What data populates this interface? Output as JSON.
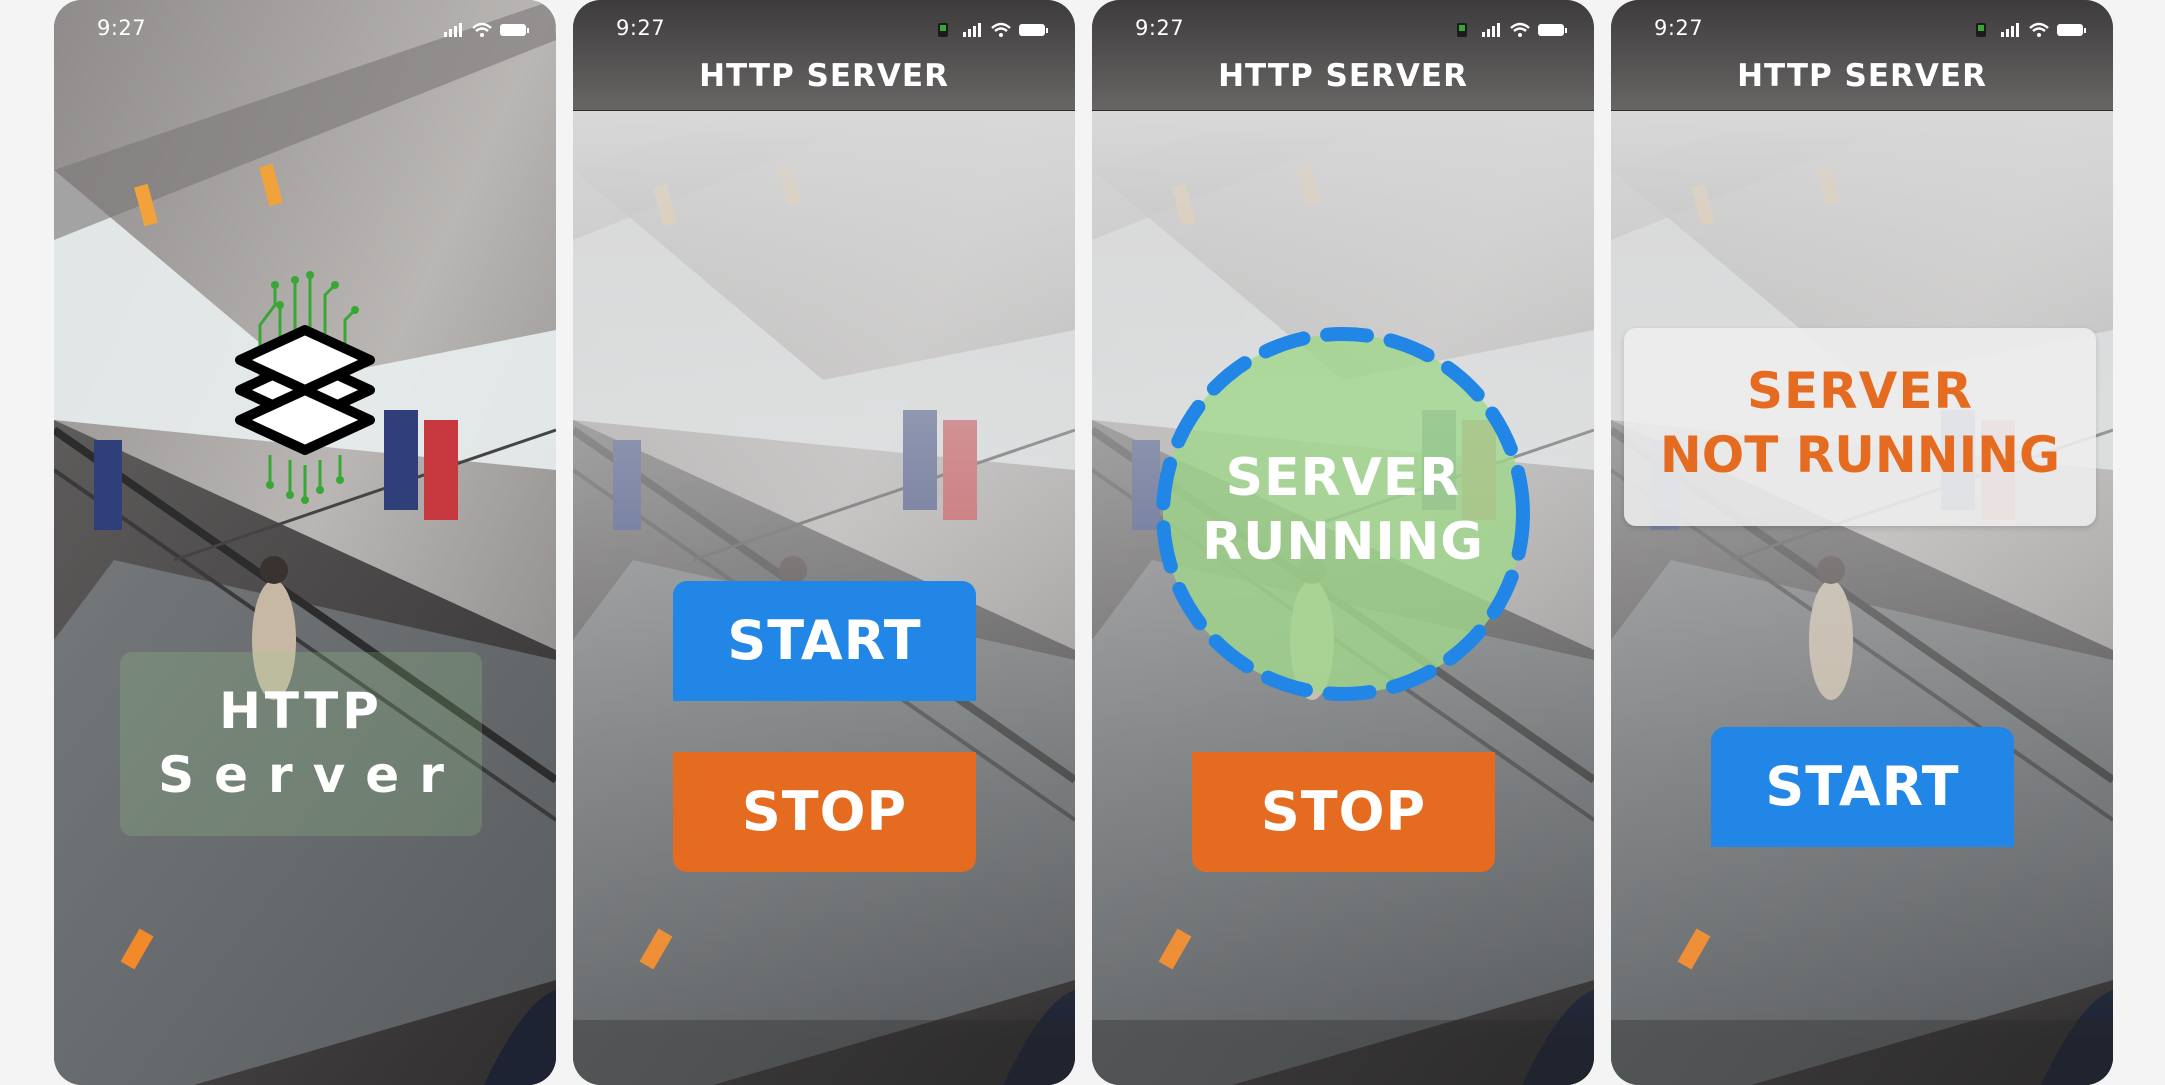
{
  "screens": [
    {
      "time": "9:27",
      "splash": {
        "title_line1": "HTTP",
        "title_line2": "Server"
      }
    },
    {
      "time": "9:27",
      "nav_title": "HTTP SERVER",
      "start_label": "START",
      "stop_label": "STOP"
    },
    {
      "time": "9:27",
      "nav_title": "HTTP SERVER",
      "status_line1": "SERVER",
      "status_line2": "RUNNING",
      "stop_label": "STOP"
    },
    {
      "time": "9:27",
      "nav_title": "HTTP SERVER",
      "status_line1": "SERVER",
      "status_line2": "NOT RUNNING",
      "start_label": "START"
    }
  ],
  "colors": {
    "accent_blue": "#2286e6",
    "accent_orange": "#e56b20",
    "running_green": "#a8d890",
    "logo_green": "#3aa635"
  },
  "icons": [
    "signal-icon",
    "wifi-icon",
    "battery-icon",
    "app-indicator-icon",
    "server-stack-logo"
  ]
}
